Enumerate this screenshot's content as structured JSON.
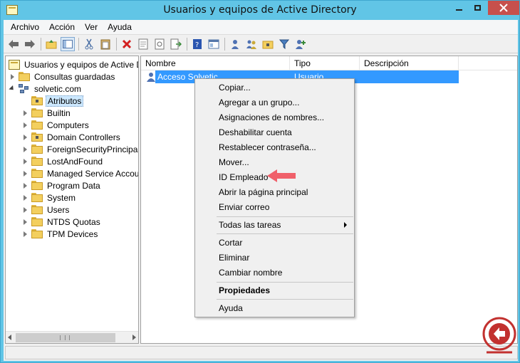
{
  "window": {
    "title": "Usuarios y equipos de Active Directory"
  },
  "menubar": {
    "items": [
      "Archivo",
      "Acción",
      "Ver",
      "Ayuda"
    ]
  },
  "toolbar": {
    "buttons": [
      "back-icon",
      "forward-icon",
      "up-folder-icon",
      "show-tree-icon",
      "cut-icon",
      "paste-icon",
      "delete-icon",
      "properties-icon",
      "refresh-icon",
      "export-icon",
      "help-icon",
      "console-icon",
      "new-user-icon",
      "new-group-icon",
      "new-ou-icon",
      "filter-icon",
      "add-to-group-icon"
    ]
  },
  "tree": {
    "root": "Usuarios y equipos de Active Directory",
    "saved_queries": "Consultas guardadas",
    "domain": "solvetic.com",
    "selected": "Atributos",
    "children": [
      "Builtin",
      "Computers",
      "Domain Controllers",
      "ForeignSecurityPrincipals",
      "LostAndFound",
      "Managed Service Accounts",
      "Program Data",
      "System",
      "Users",
      "NTDS Quotas",
      "TPM Devices"
    ]
  },
  "list": {
    "columns": [
      "Nombre",
      "Tipo",
      "Descripción"
    ],
    "rows": [
      {
        "name": "Acceso Solvetic",
        "type": "Usuario",
        "description": ""
      }
    ]
  },
  "context_menu": {
    "items": [
      "Copiar...",
      "Agregar a un grupo...",
      "Asignaciones de nombres...",
      "Deshabilitar cuenta",
      "Restablecer contraseña...",
      "Mover...",
      "ID Empleado",
      "Abrir la página principal",
      "Enviar correo",
      "Todas las tareas",
      "Cortar",
      "Eliminar",
      "Cambiar nombre",
      "Propiedades",
      "Ayuda"
    ]
  },
  "colors": {
    "titlebar": "#61c5e6",
    "close_button": "#c7504c",
    "selection": "#3399ff",
    "annotation_arrow": "#f0606a",
    "watermark": "#c2312f"
  }
}
